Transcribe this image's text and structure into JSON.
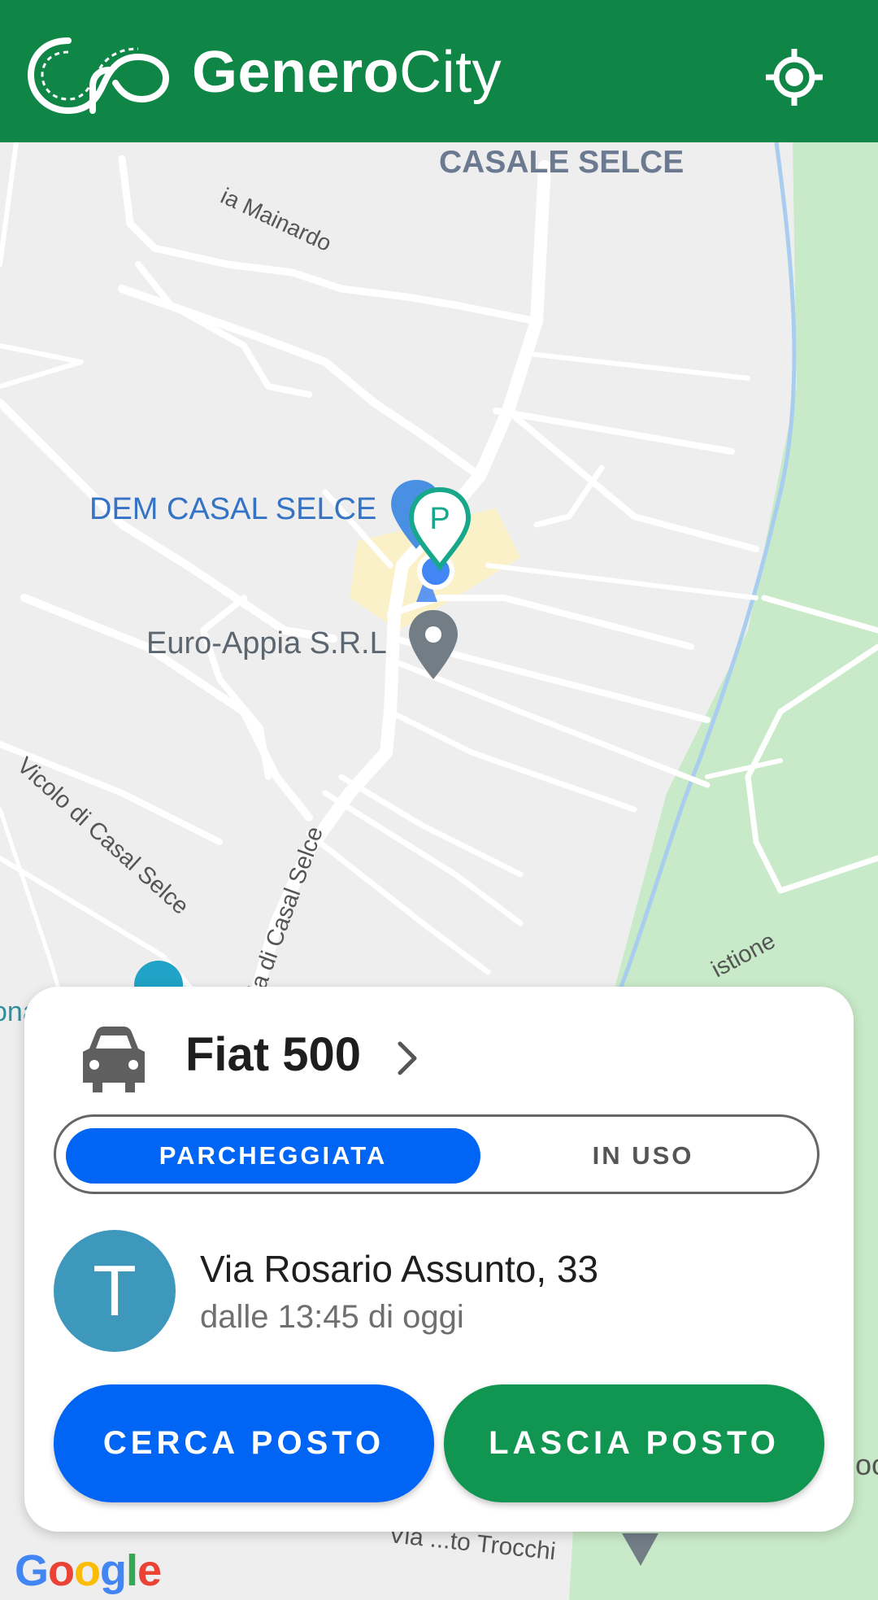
{
  "header": {
    "brand_bold": "Genero",
    "brand_light": "City",
    "logo_icon": "infinity-road-logo",
    "locate_icon": "gps-locate-icon",
    "bg_color": "#0f8546"
  },
  "map": {
    "labels": {
      "casale_selce": "CASALE SELCE",
      "via_mainardo": "ia Mainardo",
      "dem_casal_selce": "DEM CASAL SELCE",
      "euro_appia": "Euro-Appia S.R.L",
      "vicolo": "Vicolo di Casal Selce",
      "via_casal_selce": "ia di Casal Selce",
      "istione": "istione",
      "ona": "ona",
      "vocchi": "Via ...to Trocchi",
      "oc": "oc"
    },
    "google_logo": "Google"
  },
  "card": {
    "car_icon": "car-icon",
    "car_name": "Fiat 500",
    "toggle": {
      "active": "PARCHEGGIATA",
      "inactive": "IN USO"
    },
    "avatar_letter": "T",
    "address": "Via Rosario Assunto,  33",
    "since": "dalle 13:45 di oggi",
    "search_button": "CERCA POSTO",
    "leave_button": "LASCIA POSTO",
    "primary_color": "#0064f5",
    "green_color": "#109650"
  }
}
